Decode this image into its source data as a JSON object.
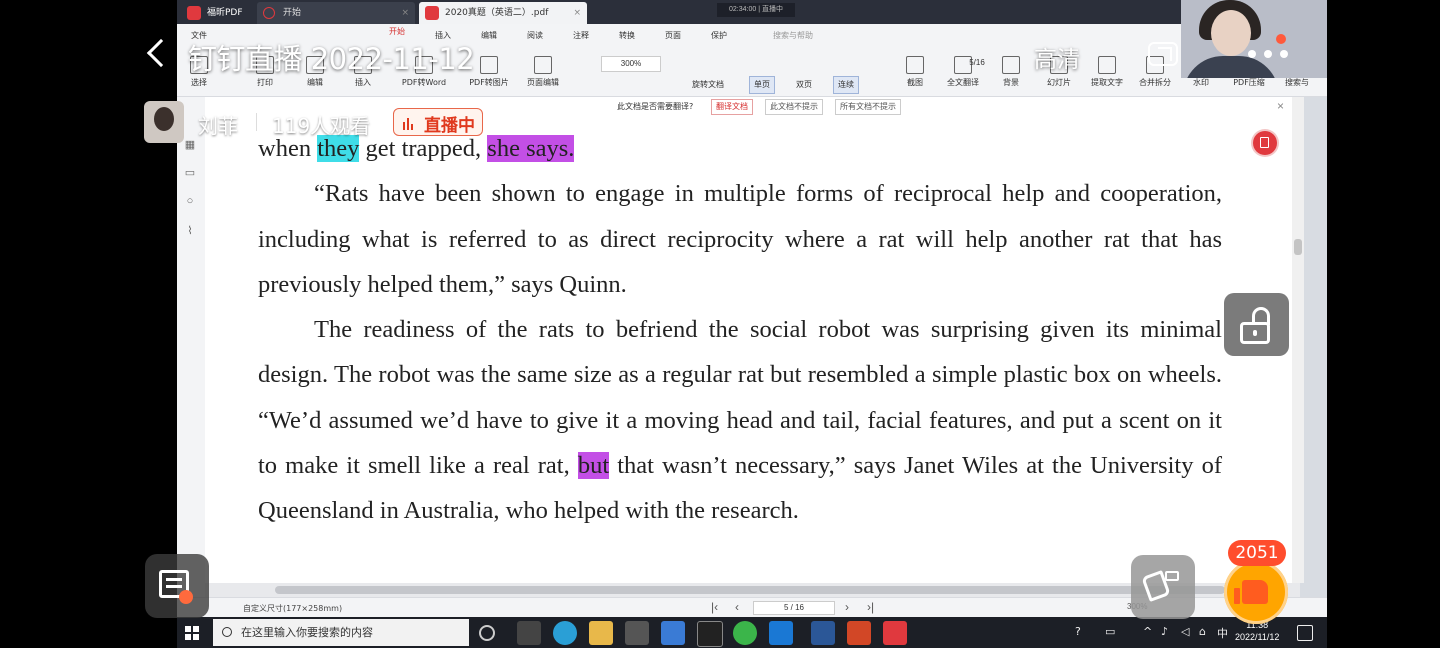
{
  "stream": {
    "title": "钉钉直播 2022-11-12",
    "quality": "高清",
    "host_name": "刘菲",
    "viewers": "119人观看",
    "live_badge": "直播中",
    "like_count": "2051"
  },
  "pdf_app": {
    "tabs": [
      {
        "label": "福昕PDF"
      },
      {
        "label": "开始"
      },
      {
        "label": "2020真题（英语二）.pdf"
      }
    ],
    "recording_indicator": "02:34:00 | 直播中",
    "menu": [
      "文件",
      "开始",
      "插入",
      "编辑",
      "阅读",
      "注释",
      "转换",
      "页面",
      "保护"
    ],
    "search_placeholder": "搜索与帮助",
    "toolbar": [
      "选择",
      "打印",
      "编辑",
      "插入",
      "PDF转Word",
      "PDF转图片",
      "页面编辑",
      "截图",
      "全文翻译",
      "背景",
      "幻灯片",
      "提取文字",
      "合并拆分",
      "水印",
      "PDF压缩",
      "搜索与"
    ],
    "zoom": "300%",
    "page_indicator": "5/16",
    "view_buttons": [
      "旋转文档",
      "单页",
      "双页",
      "连续"
    ],
    "translation_bar": {
      "question": "此文档是否需要翻译?",
      "translate_btn": "翻译文档",
      "no_prompt_doc": "此文档不提示",
      "no_prompt_all": "所有文档不提示"
    },
    "status": {
      "page_size": "自定义尺寸(177×258mm)",
      "page_nav": "5 / 16",
      "zoom": "300%"
    }
  },
  "document": {
    "line0_pre": "when ",
    "line0_hl1": "they",
    "line0_mid": " get trapped, ",
    "line0_hl2": "she says.",
    "para1": "“Rats have been shown to engage in multiple forms of reciprocal help and cooperation, including what is referred to as direct reciprocity where a rat will help another rat that has previously helped them,” says Quinn.",
    "para2_a": "The readiness of the rats to befriend the social robot was surprising given its minimal design. The robot was the same size as a regular rat but resembled a simple plastic box on wheels. “We’d assumed we’d have to give it a moving head and tail, facial features, and put a scent on it to make it smell like a real rat, ",
    "para2_hl": "but",
    "para2_b": " that wasn’t necessary,” says Janet Wiles at the University of Queensland in Australia, who helped with the research."
  },
  "taskbar": {
    "search_placeholder": "在这里输入你要搜索的内容",
    "ime": "中",
    "time": "11:38",
    "date": "2022/11/12"
  },
  "colors": {
    "highlight_cyan": "#3fdde8",
    "highlight_magenta": "#c34fe6",
    "live_red": "#e0391e",
    "like_orange": "#ffa500"
  }
}
